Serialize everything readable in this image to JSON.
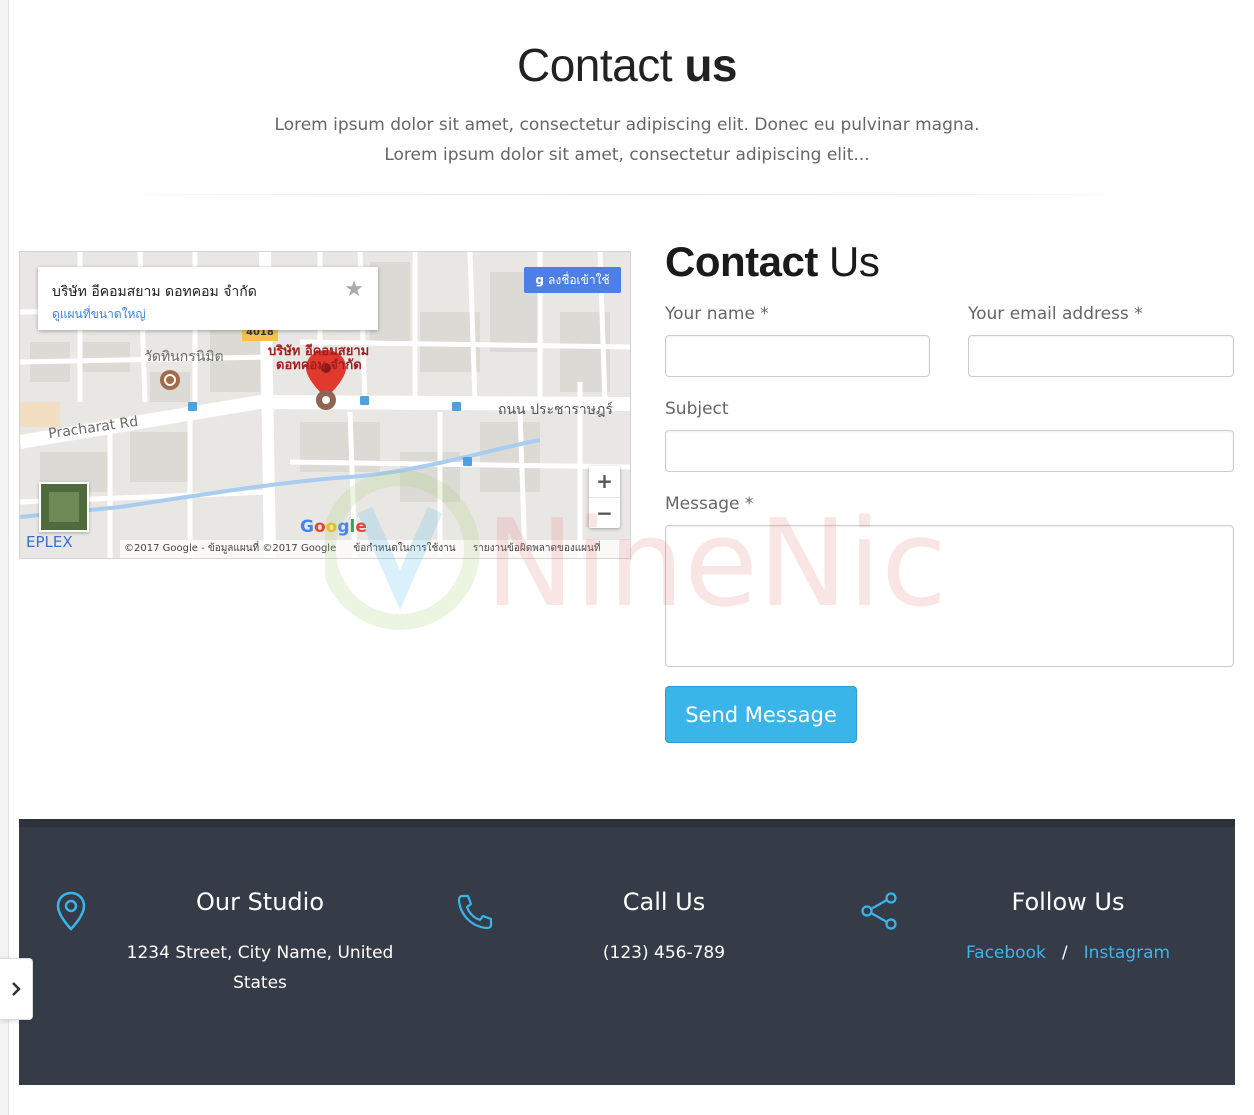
{
  "header": {
    "title_light": "Contact",
    "title_bold": "us",
    "lines": [
      "Lorem ipsum dolor sit amet, consectetur adipiscing elit. Donec eu pulvinar magna.",
      "Lorem ipsum dolor sit amet, consectetur adipiscing elit..."
    ]
  },
  "map": {
    "place_name": "บริษัท อีคอมสยาม ดอทคอม จำกัด",
    "view_larger": "ดูแผนที่ขนาดใหญ่",
    "signin": "ลงชื่อเข้าใช้",
    "signin_glyph": "g",
    "labels": {
      "temple": "วัดทินกรนิมิต",
      "road_pracharat": "Pracharat Rd",
      "road_thai": "ถนน ประชาราษฎร์",
      "marker_line1": "บริษัท อีคอมสยาม",
      "marker_line2": "ดอทคอม จำกัด",
      "route_badge": "4018",
      "eplex": "EPLEX"
    },
    "footer": {
      "copyright": "©2017 Google - ข้อมูลแผนที่ ©2017 Google",
      "terms": "ข้อกำหนดในการใช้งาน",
      "report": "รายงานข้อผิดพลาดของแผนที่"
    },
    "zoom_in": "+",
    "zoom_out": "−",
    "google": "Google"
  },
  "form": {
    "title_bold": "Contact",
    "title_light": "Us",
    "name_label": "Your name *",
    "email_label": "Your email address *",
    "subject_label": "Subject",
    "message_label": "Message *",
    "name_value": "",
    "email_value": "",
    "subject_value": "",
    "message_value": "",
    "send_label": "Send Message"
  },
  "watermark": "NineNic",
  "footer": {
    "studio": {
      "title": "Our Studio",
      "text": "1234 Street, City Name, United States"
    },
    "call": {
      "title": "Call Us",
      "text": "(123) 456-789"
    },
    "follow": {
      "title": "Follow Us",
      "facebook": "Facebook",
      "separator": "/",
      "instagram": "Instagram"
    }
  },
  "colors": {
    "accent": "#3ab5ea",
    "footer_bg": "#353c47",
    "icon_blue": "#3ab5ea"
  },
  "icons": [
    "map-pin-icon",
    "phone-icon",
    "share-icon",
    "chevron-right-icon",
    "star-icon"
  ]
}
